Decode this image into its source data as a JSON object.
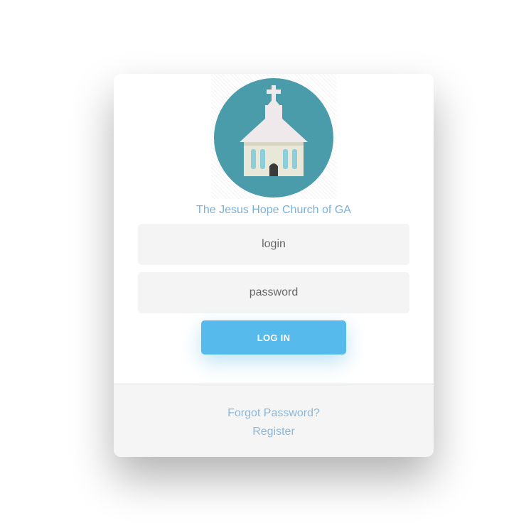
{
  "organization": {
    "name": "The Jesus Hope Church of GA",
    "logo_icon": "church-icon"
  },
  "form": {
    "login_placeholder": "login",
    "password_placeholder": "password",
    "submit_label": "LOG IN"
  },
  "footer": {
    "forgot_password_label": "Forgot Password?",
    "register_label": "Register"
  },
  "colors": {
    "accent": "#56baed",
    "link": "#8db7d9",
    "logo_circle": "#4a9caa",
    "field_background": "#f4f4f4",
    "footer_background": "#f5f5f5"
  }
}
